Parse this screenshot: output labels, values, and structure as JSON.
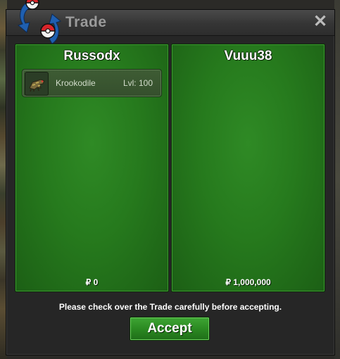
{
  "window": {
    "title": "Trade",
    "close_icon": "close-icon"
  },
  "left_trader": {
    "name": "Russodx",
    "items": [
      {
        "name": "Krookodile",
        "level": "Lvl: 100",
        "icon": "krookodile-icon"
      }
    ],
    "money": "₽ 0"
  },
  "right_trader": {
    "name": "Vuuu38",
    "items": [],
    "money": "₽ 1,000,000"
  },
  "footer": {
    "message": "Please check over the Trade carefully before accepting.",
    "accept_label": "Accept"
  },
  "colors": {
    "panel_green": "#267a1d",
    "accept_green": "#2b8a22",
    "titlebar": "#353535"
  }
}
